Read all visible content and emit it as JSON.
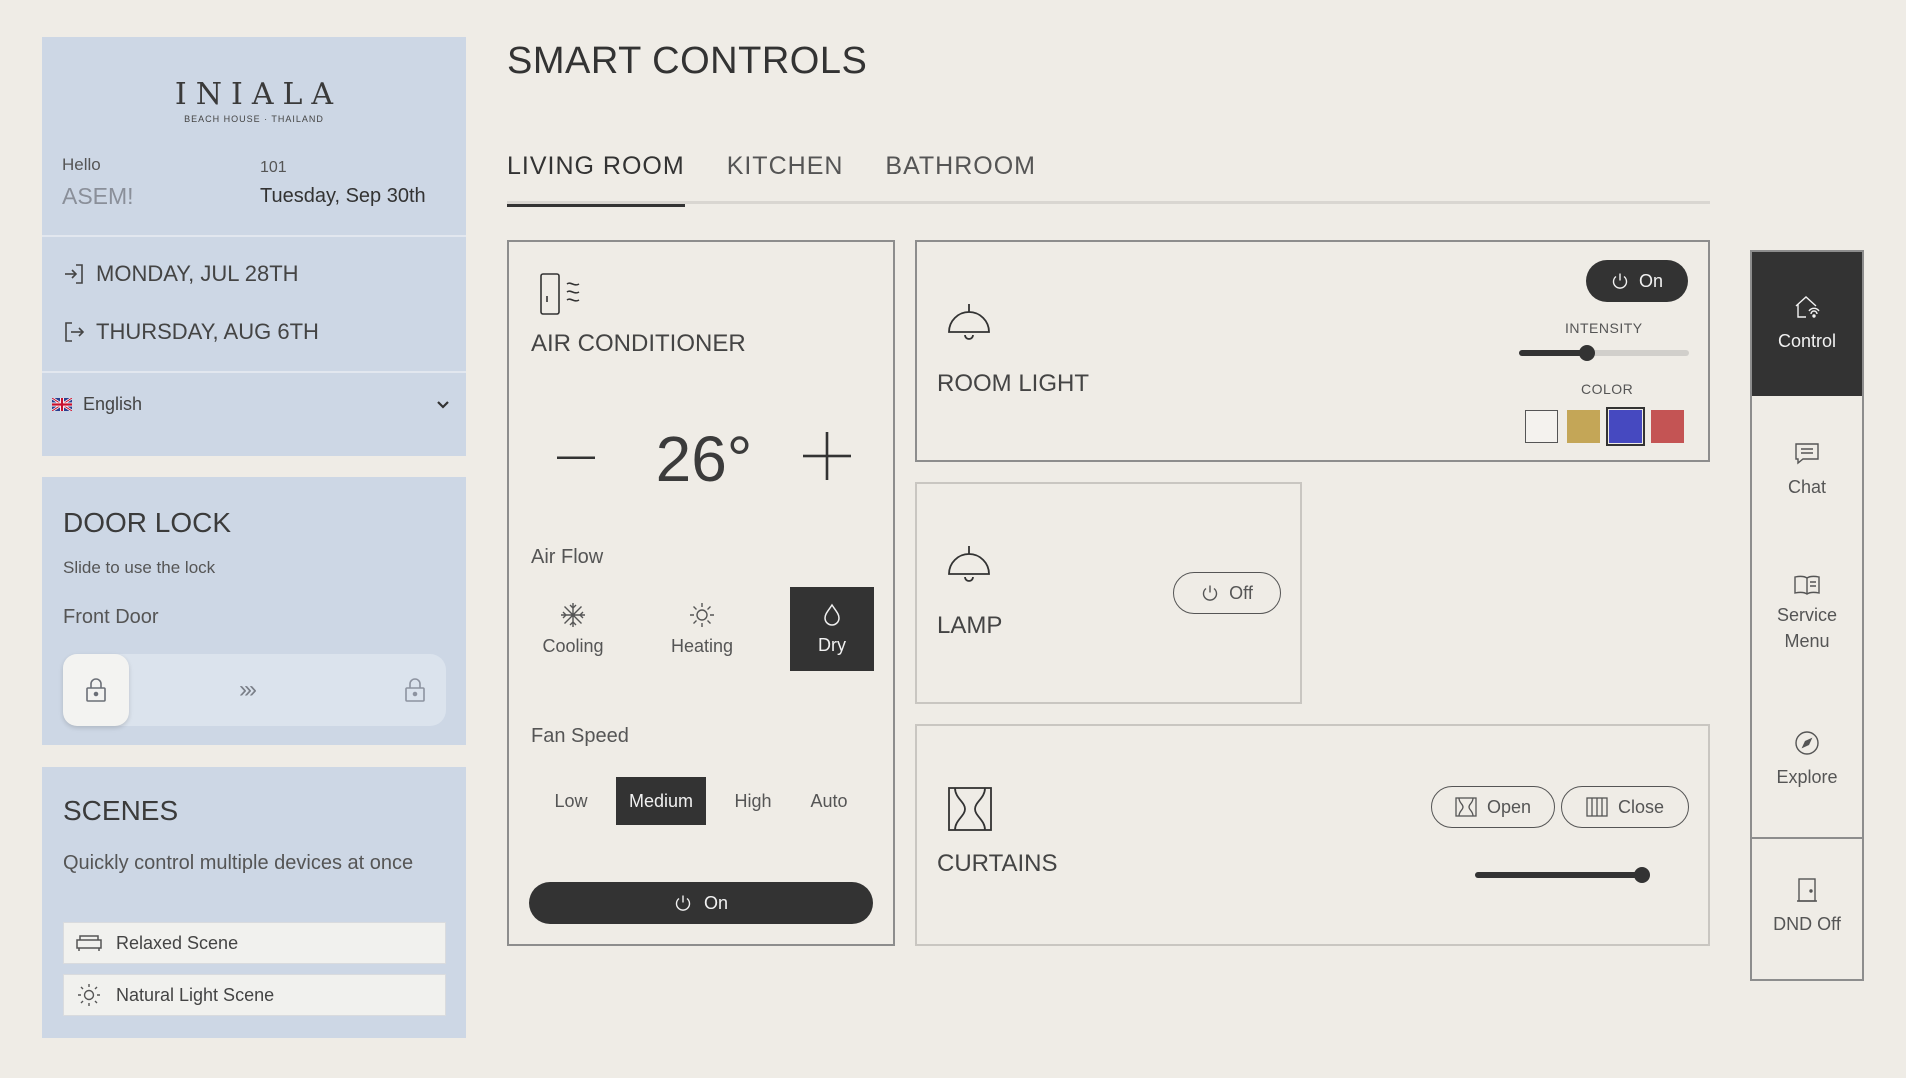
{
  "guest": {
    "logo": "INIALA",
    "logo_sub": "BEACH HOUSE · THAILAND",
    "greeting": "Hello",
    "name": "ASEM!",
    "room": "101",
    "today": "Tuesday, Sep 30th",
    "checkin": "MONDAY, JUL 28TH",
    "checkout": "THURSDAY, AUG 6TH",
    "language": "English"
  },
  "door_lock": {
    "title": "DOOR LOCK",
    "subtitle": "Slide to use the lock",
    "door_name": "Front Door",
    "arrows": "›››"
  },
  "scenes": {
    "title": "SCENES",
    "subtitle": "Quickly control multiple devices at once",
    "items": [
      {
        "label": "Relaxed Scene",
        "icon": "sofa-icon"
      },
      {
        "label": "Natural Light Scene",
        "icon": "sun-icon"
      }
    ]
  },
  "page_title": "SMART CONTROLS",
  "tabs": [
    {
      "label": "LIVING ROOM",
      "active": true
    },
    {
      "label": "KITCHEN",
      "active": false
    },
    {
      "label": "BATHROOM",
      "active": false
    }
  ],
  "air_conditioner": {
    "title": "AIR CONDITIONER",
    "temperature": "26°",
    "airflow_label": "Air Flow",
    "modes": [
      {
        "label": "Cooling",
        "icon": "snowflake-icon",
        "active": false
      },
      {
        "label": "Heating",
        "icon": "sun-icon",
        "active": false
      },
      {
        "label": "Dry",
        "icon": "droplet-icon",
        "active": true
      }
    ],
    "fan_label": "Fan Speed",
    "fan_speeds": [
      {
        "label": "Low",
        "active": false
      },
      {
        "label": "Medium",
        "active": true
      },
      {
        "label": "High",
        "active": false
      },
      {
        "label": "Auto",
        "active": false
      }
    ],
    "power_label": "On"
  },
  "room_light": {
    "title": "ROOM LIGHT",
    "power_label": "On",
    "intensity_label": "INTENSITY",
    "intensity": 0.4,
    "color_label": "COLOR",
    "colors": [
      "#f4f2ee",
      "#c4a657",
      "#4649c0",
      "#c45454"
    ],
    "selected_color": 2
  },
  "lamp": {
    "title": "LAMP",
    "power_label": "Off"
  },
  "curtains": {
    "title": "CURTAINS",
    "open_label": "Open",
    "close_label": "Close",
    "position": 0.98
  },
  "nav": {
    "control": "Control",
    "chat": "Chat",
    "service_menu_1": "Service",
    "service_menu_2": "Menu",
    "explore": "Explore",
    "dnd": "DND Off"
  }
}
